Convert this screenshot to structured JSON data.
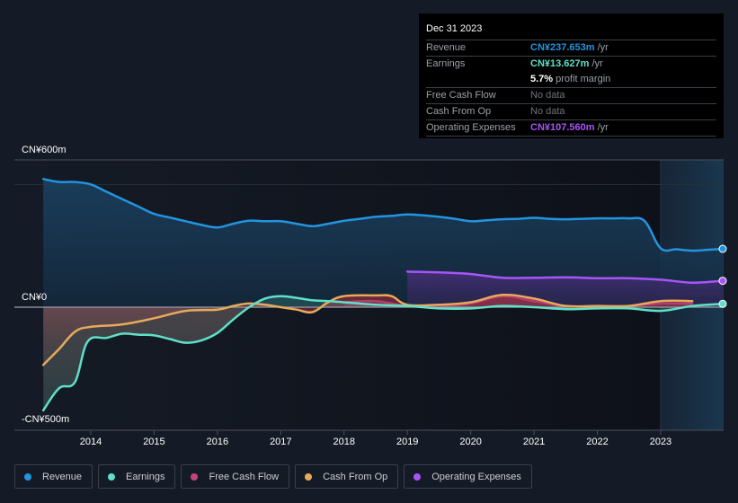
{
  "tooltip": {
    "date": "Dec 31 2023",
    "rows": [
      {
        "label": "Revenue",
        "value": "CN¥237.653m",
        "unit": " /yr",
        "color": "#2394df"
      },
      {
        "label": "Earnings",
        "value": "CN¥13.627m",
        "unit": " /yr",
        "color": "#5fe0c8"
      },
      {
        "label": "",
        "value": "5.7%",
        "unit": " profit margin",
        "color": "#ffffff"
      },
      {
        "label": "Free Cash Flow",
        "value": "No data",
        "unit": "",
        "color": "#7a7f86"
      },
      {
        "label": "Cash From Op",
        "value": "No data",
        "unit": "",
        "color": "#7a7f86"
      },
      {
        "label": "Operating Expenses",
        "value": "CN¥107.560m",
        "unit": " /yr",
        "color": "#a855f7"
      }
    ]
  },
  "legend": [
    {
      "label": "Revenue",
      "color": "#2394df"
    },
    {
      "label": "Earnings",
      "color": "#5fe0c8"
    },
    {
      "label": "Free Cash Flow",
      "color": "#c2447c"
    },
    {
      "label": "Cash From Op",
      "color": "#e8a95b"
    },
    {
      "label": "Operating Expenses",
      "color": "#a855f7"
    }
  ],
  "chart_data": {
    "type": "line",
    "title": "",
    "xlabel": "",
    "ylabel": "",
    "y_tick_labels": [
      {
        "value": 600,
        "label": "CN¥600m"
      },
      {
        "value": 0,
        "label": "CN¥0"
      },
      {
        "value": -500,
        "label": "-CN¥500m"
      }
    ],
    "x_tick_labels": [
      "2014",
      "2015",
      "2016",
      "2017",
      "2018",
      "2019",
      "2020",
      "2021",
      "2022",
      "2023"
    ],
    "x_ticks": [
      2014,
      2015,
      2016,
      2017,
      2018,
      2019,
      2020,
      2021,
      2022,
      2023
    ],
    "xlim": [
      2012.75,
      2024.0
    ],
    "ylim": [
      -500,
      600
    ],
    "unit": "CN¥ millions",
    "highlight_start": 2023.0,
    "series": [
      {
        "name": "Revenue",
        "color": "#2394df",
        "points": [
          [
            2013.25,
            522
          ],
          [
            2013.5,
            510
          ],
          [
            2013.75,
            510
          ],
          [
            2014.0,
            500
          ],
          [
            2014.25,
            470
          ],
          [
            2014.5,
            440
          ],
          [
            2014.75,
            410
          ],
          [
            2015.0,
            380
          ],
          [
            2015.25,
            365
          ],
          [
            2015.5,
            350
          ],
          [
            2015.75,
            335
          ],
          [
            2016.0,
            325
          ],
          [
            2016.25,
            340
          ],
          [
            2016.5,
            352
          ],
          [
            2016.75,
            350
          ],
          [
            2017.0,
            350
          ],
          [
            2017.25,
            340
          ],
          [
            2017.5,
            330
          ],
          [
            2017.75,
            340
          ],
          [
            2018.0,
            352
          ],
          [
            2018.25,
            360
          ],
          [
            2018.5,
            368
          ],
          [
            2018.75,
            372
          ],
          [
            2019.0,
            378
          ],
          [
            2019.25,
            374
          ],
          [
            2019.5,
            368
          ],
          [
            2019.75,
            360
          ],
          [
            2020.0,
            350
          ],
          [
            2020.25,
            354
          ],
          [
            2020.5,
            358
          ],
          [
            2020.75,
            360
          ],
          [
            2021.0,
            364
          ],
          [
            2021.25,
            360
          ],
          [
            2021.5,
            358
          ],
          [
            2021.75,
            360
          ],
          [
            2022.0,
            362
          ],
          [
            2022.25,
            362
          ],
          [
            2022.5,
            362
          ],
          [
            2022.75,
            350
          ],
          [
            2023.0,
            240
          ],
          [
            2023.25,
            236
          ],
          [
            2023.5,
            230
          ],
          [
            2023.75,
            234
          ],
          [
            2023.98,
            237.653
          ]
        ]
      },
      {
        "name": "Earnings",
        "color": "#5fe0c8",
        "points": [
          [
            2013.25,
            -420
          ],
          [
            2013.5,
            -330
          ],
          [
            2013.75,
            -305
          ],
          [
            2013.95,
            -140
          ],
          [
            2014.25,
            -125
          ],
          [
            2014.5,
            -108
          ],
          [
            2014.75,
            -112
          ],
          [
            2015.0,
            -115
          ],
          [
            2015.25,
            -130
          ],
          [
            2015.5,
            -145
          ],
          [
            2015.75,
            -135
          ],
          [
            2016.0,
            -105
          ],
          [
            2016.25,
            -50
          ],
          [
            2016.5,
            0
          ],
          [
            2016.75,
            35
          ],
          [
            2017.0,
            45
          ],
          [
            2017.25,
            38
          ],
          [
            2017.5,
            28
          ],
          [
            2017.75,
            25
          ],
          [
            2018.0,
            20
          ],
          [
            2018.5,
            10
          ],
          [
            2019.0,
            5
          ],
          [
            2019.5,
            -5
          ],
          [
            2020.0,
            -5
          ],
          [
            2020.5,
            5
          ],
          [
            2021.0,
            0
          ],
          [
            2021.5,
            -8
          ],
          [
            2022.0,
            -5
          ],
          [
            2022.5,
            -5
          ],
          [
            2023.0,
            -15
          ],
          [
            2023.5,
            5
          ],
          [
            2023.98,
            13.627
          ]
        ]
      },
      {
        "name": "Free Cash Flow",
        "color": "#c2447c",
        "points": [
          [
            2018.0,
            20
          ],
          [
            2018.5,
            25
          ],
          [
            2019.0,
            5
          ],
          [
            2019.5,
            5
          ],
          [
            2020.0,
            15
          ],
          [
            2020.5,
            45
          ],
          [
            2021.0,
            25
          ],
          [
            2021.5,
            5
          ],
          [
            2022.0,
            5
          ],
          [
            2022.5,
            5
          ],
          [
            2023.0,
            15
          ],
          [
            2023.5,
            15
          ]
        ]
      },
      {
        "name": "Cash From Op",
        "color": "#e8a95b",
        "points": [
          [
            2013.25,
            -235
          ],
          [
            2013.5,
            -170
          ],
          [
            2013.75,
            -100
          ],
          [
            2014.0,
            -80
          ],
          [
            2014.5,
            -70
          ],
          [
            2015.0,
            -45
          ],
          [
            2015.5,
            -15
          ],
          [
            2016.0,
            -10
          ],
          [
            2016.25,
            5
          ],
          [
            2016.5,
            15
          ],
          [
            2016.75,
            10
          ],
          [
            2017.0,
            0
          ],
          [
            2017.25,
            -10
          ],
          [
            2017.5,
            -20
          ],
          [
            2017.75,
            20
          ],
          [
            2018.0,
            45
          ],
          [
            2018.5,
            48
          ],
          [
            2018.75,
            45
          ],
          [
            2019.0,
            10
          ],
          [
            2019.5,
            10
          ],
          [
            2020.0,
            20
          ],
          [
            2020.5,
            50
          ],
          [
            2021.0,
            35
          ],
          [
            2021.5,
            5
          ],
          [
            2022.0,
            5
          ],
          [
            2022.5,
            5
          ],
          [
            2023.0,
            25
          ],
          [
            2023.5,
            25
          ]
        ]
      },
      {
        "name": "Operating Expenses",
        "color": "#a855f7",
        "points": [
          [
            2019.0,
            145
          ],
          [
            2019.5,
            142
          ],
          [
            2020.0,
            135
          ],
          [
            2020.5,
            120
          ],
          [
            2021.0,
            120
          ],
          [
            2021.5,
            122
          ],
          [
            2022.0,
            118
          ],
          [
            2022.5,
            118
          ],
          [
            2023.0,
            112
          ],
          [
            2023.5,
            100
          ],
          [
            2023.98,
            107.56
          ]
        ]
      }
    ]
  }
}
